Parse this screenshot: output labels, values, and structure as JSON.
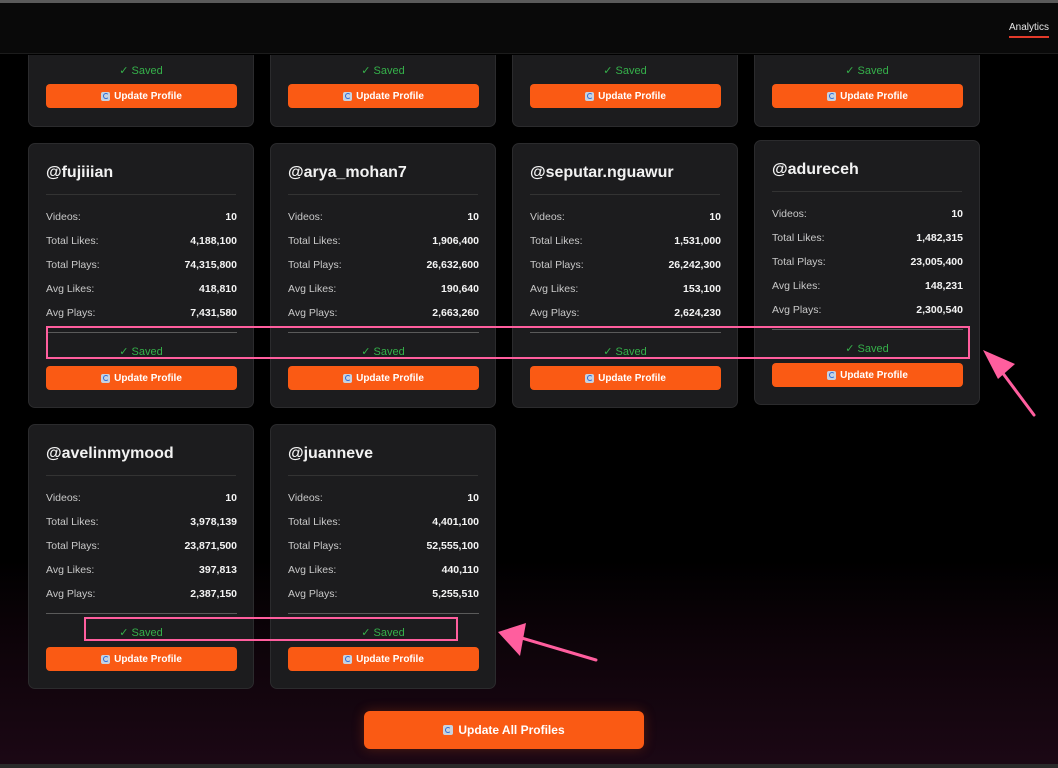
{
  "nav": {
    "analytics": "Analytics"
  },
  "labels": {
    "videos": "Videos:",
    "total_likes": "Total Likes:",
    "total_plays": "Total Plays:",
    "avg_likes": "Avg Likes:",
    "avg_plays": "Avg Plays:",
    "saved": "✓ Saved",
    "update_profile": "Update Profile"
  },
  "top_cards": [
    {
      "saved": "✓ Saved",
      "button": "Update Profile"
    },
    {
      "saved": "✓ Saved",
      "button": "Update Profile"
    },
    {
      "saved": "✓ Saved",
      "button": "Update Profile"
    },
    {
      "saved": "✓ Saved",
      "button": "Update Profile"
    }
  ],
  "profiles": [
    {
      "handle": "@fujiiian",
      "videos": "10",
      "total_likes": "4,188,100",
      "total_plays": "74,315,800",
      "avg_likes": "418,810",
      "avg_plays": "7,431,580",
      "saved": "✓ Saved",
      "button": "Update Profile"
    },
    {
      "handle": "@arya_mohan7",
      "videos": "10",
      "total_likes": "1,906,400",
      "total_plays": "26,632,600",
      "avg_likes": "190,640",
      "avg_plays": "2,663,260",
      "saved": "✓ Saved",
      "button": "Update Profile"
    },
    {
      "handle": "@seputar.nguawur",
      "videos": "10",
      "total_likes": "1,531,000",
      "total_plays": "26,242,300",
      "avg_likes": "153,100",
      "avg_plays": "2,624,230",
      "saved": "✓ Saved",
      "button": "Update Profile"
    },
    {
      "handle": "@adureceh",
      "videos": "10",
      "total_likes": "1,482,315",
      "total_plays": "23,005,400",
      "avg_likes": "148,231",
      "avg_plays": "2,300,540",
      "saved": "✓ Saved",
      "button": "Update Profile"
    },
    {
      "handle": "@avelinmymood",
      "videos": "10",
      "total_likes": "3,978,139",
      "total_plays": "23,871,500",
      "avg_likes": "397,813",
      "avg_plays": "2,387,150",
      "saved": "✓ Saved",
      "button": "Update Profile"
    },
    {
      "handle": "@juanneve",
      "videos": "10",
      "total_likes": "4,401,100",
      "total_plays": "52,555,100",
      "avg_likes": "440,110",
      "avg_plays": "5,255,510",
      "saved": "✓ Saved",
      "button": "Update Profile"
    }
  ],
  "update_all": "Update All Profiles",
  "colors": {
    "accent": "#fa5a14",
    "saved": "#35b04a",
    "annotation": "#ff5e9e",
    "card_bg": "#1c1c1e"
  },
  "icons": {
    "refresh": "refresh-icon",
    "annotation_arrow": "arrow-icon"
  }
}
